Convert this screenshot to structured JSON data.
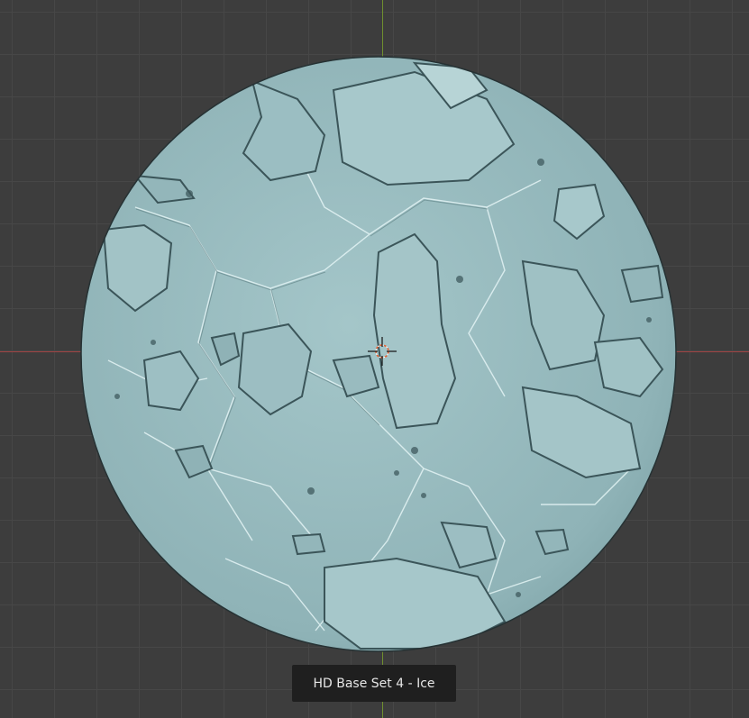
{
  "viewport": {
    "background_color": "#3d3d3d",
    "grid_color": "#474747",
    "x_axis_color": "#a04343",
    "y_axis_color": "#6f8f2f"
  },
  "model": {
    "surface_color": "#93b9bd",
    "shadow_color": "#3f5a5e",
    "highlight_color": "#d6eef0"
  },
  "cursor": {
    "icon": "3d-cursor-icon"
  },
  "label": {
    "text": "HD Base Set 4 - Ice"
  }
}
